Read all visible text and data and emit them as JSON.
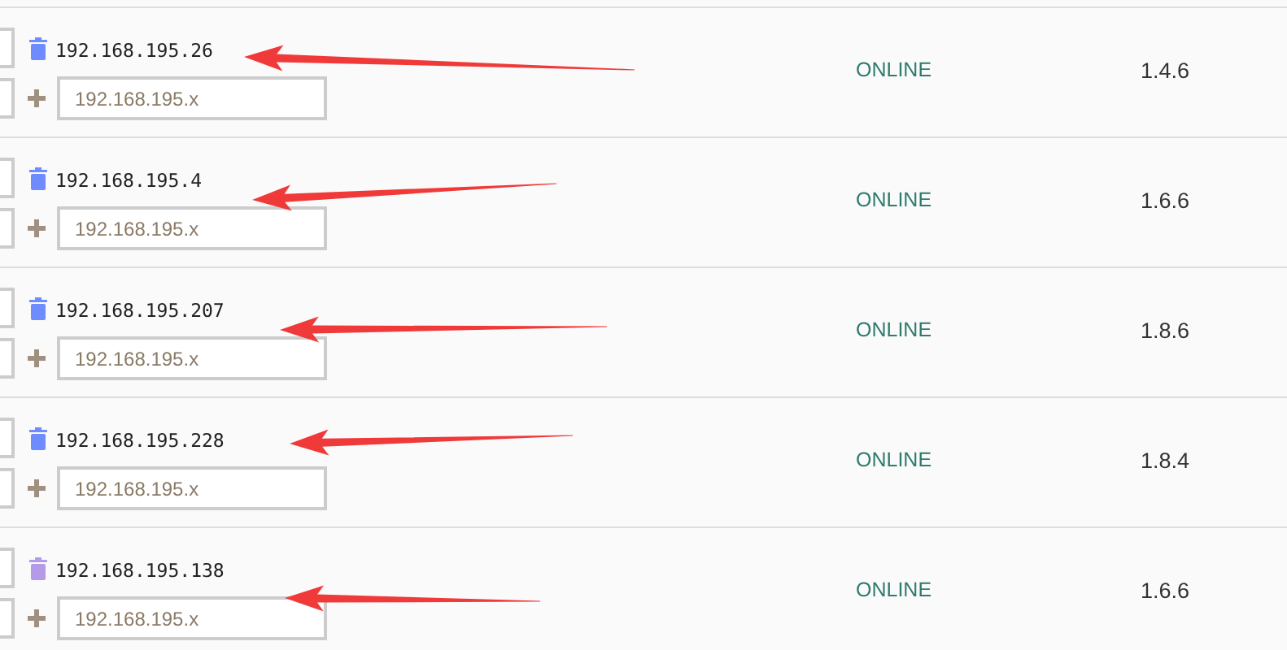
{
  "devices": [
    {
      "ip": "192.168.195.26",
      "color": "#6f8cff",
      "placeholder": "192.168.195.x",
      "status": "ONLINE",
      "version": "1.4.6",
      "arrow": true
    },
    {
      "ip": "192.168.195.4",
      "color": "#6f8cff",
      "placeholder": "192.168.195.x",
      "status": "ONLINE",
      "version": "1.6.6",
      "arrow": true
    },
    {
      "ip": "192.168.195.207",
      "color": "#6f8cff",
      "placeholder": "192.168.195.x",
      "status": "ONLINE",
      "version": "1.8.6",
      "arrow": true
    },
    {
      "ip": "192.168.195.228",
      "color": "#6f8cff",
      "placeholder": "192.168.195.x",
      "status": "ONLINE",
      "version": "1.8.4",
      "arrow": true
    },
    {
      "ip": "192.168.195.138",
      "color": "#b49be8",
      "placeholder": "192.168.195.x",
      "status": "ONLINE",
      "version": "1.6.6",
      "arrow": true
    }
  ]
}
